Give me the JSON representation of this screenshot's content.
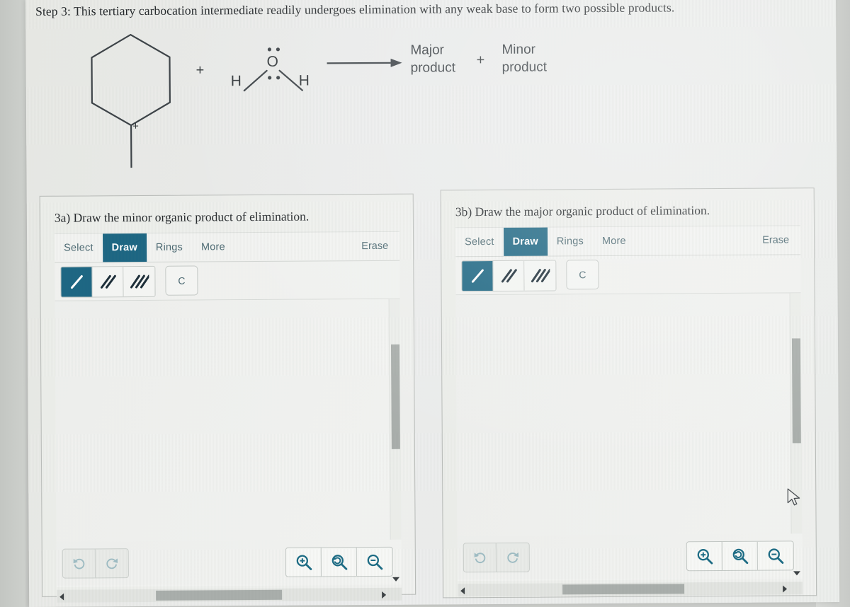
{
  "step": {
    "title": "Step 3: This tertiary carbocation intermediate readily undergoes elimination with any weak base to form two possible products."
  },
  "reaction": {
    "reactant_charge": "+",
    "plus_1": "+",
    "water": {
      "oxygen": "O",
      "hydrogen_left": "H",
      "hydrogen_right": "H"
    },
    "arrow": "reaction-arrow",
    "products": {
      "major_line1": "Major",
      "major_line2": "product",
      "plus": "+",
      "minor_line1": "Minor",
      "minor_line2": "product"
    }
  },
  "panels": [
    {
      "id": "3a",
      "question": "3a) Draw the minor organic product of elimination.",
      "toolbar": {
        "tabs": [
          {
            "label": "Select",
            "active": false
          },
          {
            "label": "Draw",
            "active": true
          },
          {
            "label": "Rings",
            "active": false
          },
          {
            "label": "More",
            "active": false
          }
        ],
        "erase_label": "Erase"
      },
      "bond_tools": [
        {
          "name": "single-bond",
          "active": true
        },
        {
          "name": "double-bond",
          "active": false
        },
        {
          "name": "triple-bond",
          "active": false
        }
      ],
      "atom_button": "C",
      "history": [
        {
          "name": "undo",
          "enabled": false
        },
        {
          "name": "redo",
          "enabled": false
        }
      ],
      "zoom_controls": [
        {
          "name": "zoom-in"
        },
        {
          "name": "zoom-reset"
        },
        {
          "name": "zoom-out"
        }
      ]
    },
    {
      "id": "3b",
      "question": "3b) Draw the major organic product of elimination.",
      "toolbar": {
        "tabs": [
          {
            "label": "Select",
            "active": false
          },
          {
            "label": "Draw",
            "active": true
          },
          {
            "label": "Rings",
            "active": false
          },
          {
            "label": "More",
            "active": false
          }
        ],
        "erase_label": "Erase"
      },
      "bond_tools": [
        {
          "name": "single-bond",
          "active": true
        },
        {
          "name": "double-bond",
          "active": false
        },
        {
          "name": "triple-bond",
          "active": false
        }
      ],
      "atom_button": "C",
      "history": [
        {
          "name": "undo",
          "enabled": false
        },
        {
          "name": "redo",
          "enabled": false
        }
      ],
      "zoom_controls": [
        {
          "name": "zoom-in"
        },
        {
          "name": "zoom-reset"
        },
        {
          "name": "zoom-out"
        }
      ]
    }
  ],
  "colors": {
    "accent_teal": "#1c6683",
    "tab_text": "#4d6a73",
    "page_bg": "#eceeec",
    "structure_ink": "#3c4247",
    "scrollbar_thumb": "#a9aeab"
  }
}
